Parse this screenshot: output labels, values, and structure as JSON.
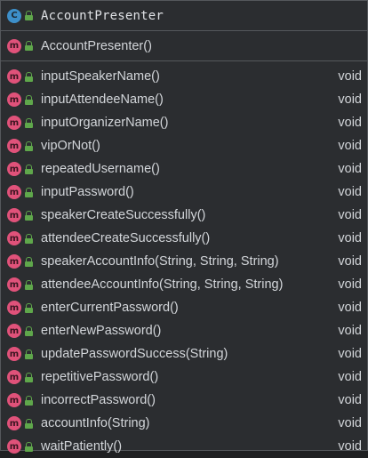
{
  "class_name": "AccountPresenter",
  "class_icon_letter": "C",
  "method_icon_letter": "m",
  "colors": {
    "class_icon": "#3d8fc9",
    "method_icon": "#e0527a",
    "public_lock": "#5fa74b",
    "background": "#2b2d30",
    "border": "#55585c"
  },
  "constructor": {
    "name": "AccountPresenter()"
  },
  "methods": [
    {
      "name": "inputSpeakerName()",
      "return_type": "void"
    },
    {
      "name": "inputAttendeeName()",
      "return_type": "void"
    },
    {
      "name": "inputOrganizerName()",
      "return_type": "void"
    },
    {
      "name": "vipOrNot()",
      "return_type": "void"
    },
    {
      "name": "repeatedUsername()",
      "return_type": "void"
    },
    {
      "name": "inputPassword()",
      "return_type": "void"
    },
    {
      "name": "speakerCreateSuccessfully()",
      "return_type": "void"
    },
    {
      "name": "attendeeCreateSuccessfully()",
      "return_type": "void"
    },
    {
      "name": "speakerAccountInfo(String, String, String)",
      "return_type": "void"
    },
    {
      "name": "attendeeAccountInfo(String, String, String)",
      "return_type": "void"
    },
    {
      "name": "enterCurrentPassword()",
      "return_type": "void"
    },
    {
      "name": "enterNewPassword()",
      "return_type": "void"
    },
    {
      "name": "updatePasswordSuccess(String)",
      "return_type": "void"
    },
    {
      "name": "repetitivePassword()",
      "return_type": "void"
    },
    {
      "name": "incorrectPassword()",
      "return_type": "void"
    },
    {
      "name": "accountInfo(String)",
      "return_type": "void"
    },
    {
      "name": "waitPatiently()",
      "return_type": "void"
    }
  ]
}
